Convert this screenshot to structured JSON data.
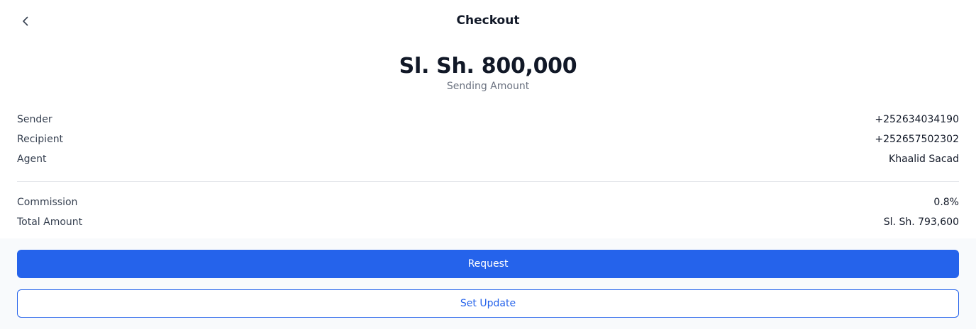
{
  "header": {
    "title": "Checkout",
    "back_icon": "chevron-left-icon"
  },
  "amount": {
    "value": "Sl. Sh. 800,000",
    "caption": "Sending Amount"
  },
  "details": [
    {
      "label": "Sender",
      "value": "+252634034190"
    },
    {
      "label": "Recipient",
      "value": "+252657502302"
    },
    {
      "label": "Agent",
      "value": "Khaalid Sacad"
    }
  ],
  "summary": [
    {
      "label": "Commission",
      "value": "0.8%"
    },
    {
      "label": "Total Amount",
      "value": "Sl. Sh. 793,600"
    }
  ],
  "actions": {
    "request_label": "Request",
    "set_update_label": "Set Update"
  },
  "colors": {
    "accent": "#2563eb",
    "footer_background": "#f8fafc",
    "divider": "#e5e7eb"
  }
}
